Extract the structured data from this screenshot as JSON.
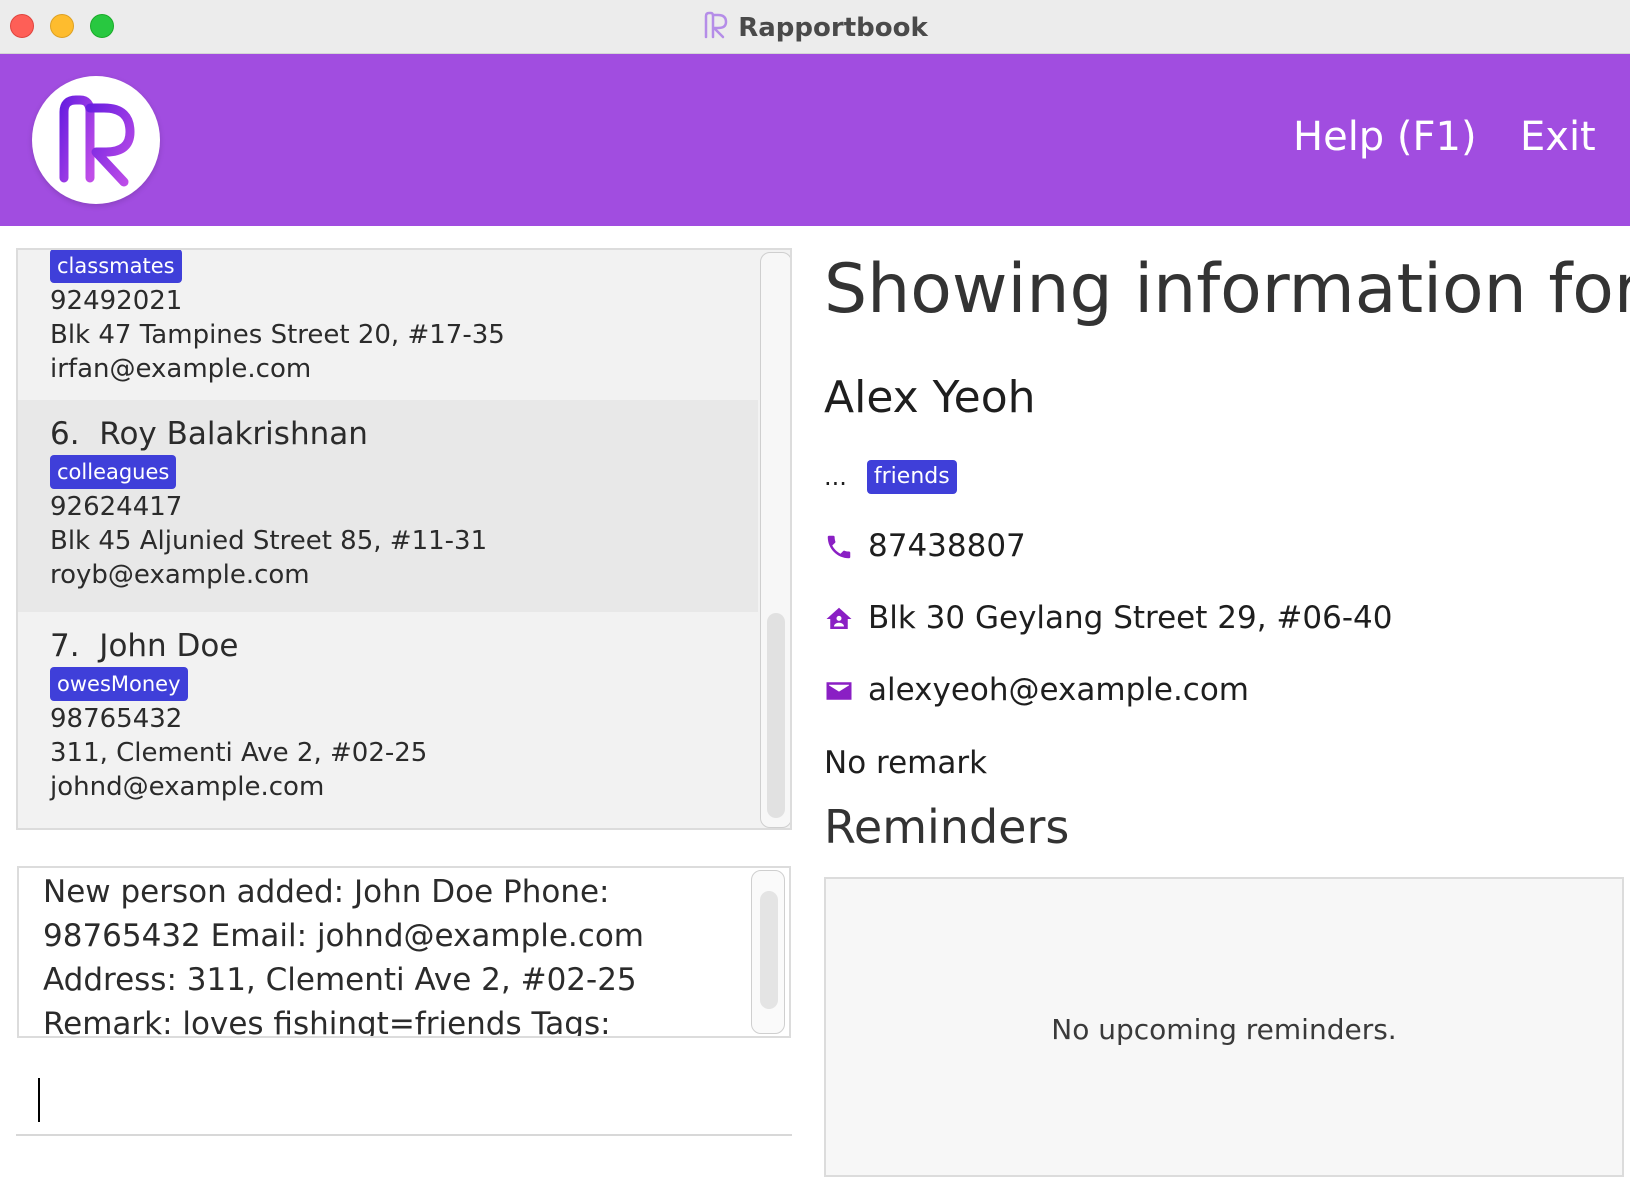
{
  "window": {
    "title": "Rapportbook"
  },
  "header": {
    "menu": [
      {
        "label": "Help (F1)"
      },
      {
        "label": "Exit"
      }
    ]
  },
  "person_list": {
    "cards": [
      {
        "tag": "classmates",
        "phone": "92492021",
        "address": "Blk 47 Tampines Street 20, #17-35",
        "email": "irfan@example.com"
      },
      {
        "index": "6.",
        "name": "Roy Balakrishnan",
        "tag": "colleagues",
        "phone": "92624417",
        "address": "Blk 45 Aljunied Street 85, #11-31",
        "email": "royb@example.com"
      },
      {
        "index": "7.",
        "name": "John Doe",
        "tag": "owesMoney",
        "phone": "98765432",
        "address": "311, Clementi Ave 2, #02-25",
        "email": "johnd@example.com"
      }
    ]
  },
  "result_display": {
    "text": "New person added: John Doe Phone: 98765432 Email: johnd@example.com Address: 311, Clementi Ave 2, #02-25 Remark: loves fishingt=friends Tags: [owesMoney]"
  },
  "command_box": {
    "value": ""
  },
  "detail": {
    "heading": "Showing information for",
    "name": "Alex Yeoh",
    "tags_prefix": "...",
    "tags": [
      "friends"
    ],
    "phone": "87438807",
    "address": "Blk 30 Geylang Street 29, #06-40",
    "email": "alexyeoh@example.com",
    "remark": "No remark",
    "reminders_title": "Reminders",
    "reminders_empty": "No upcoming reminders."
  },
  "colors": {
    "header_bg": "#a14de0",
    "tag_bg": "#3f3fd9",
    "icon_purple": "#8a1fc4"
  },
  "icons": [
    "app-logo",
    "phone-icon",
    "home-icon",
    "mail-icon"
  ]
}
